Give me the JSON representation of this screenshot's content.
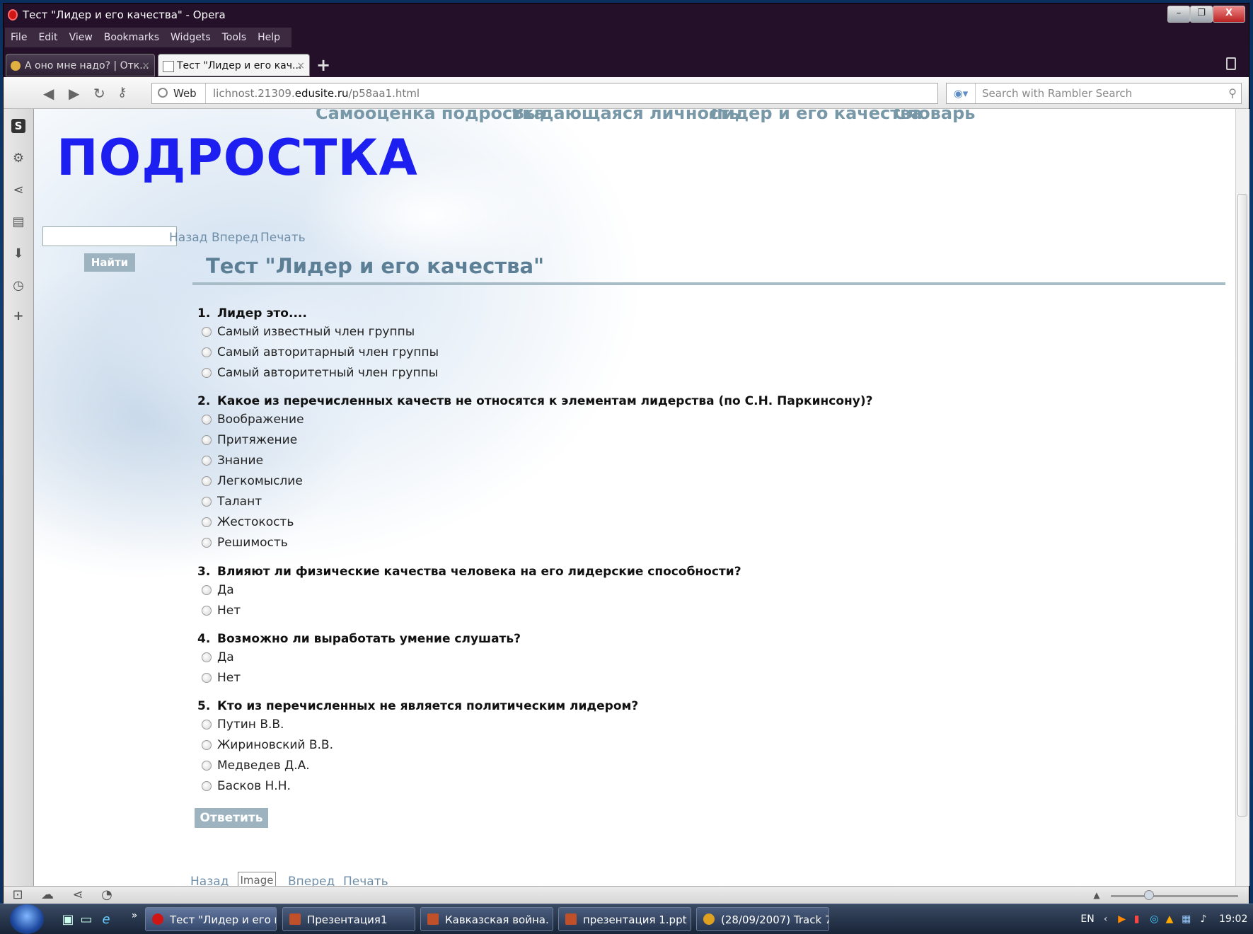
{
  "window": {
    "title": "Тест \"Лидер и его качества\" - Opera",
    "controls": {
      "minimize": "–",
      "restore": "❐",
      "close": "X"
    }
  },
  "menu": [
    "File",
    "Edit",
    "View",
    "Bookmarks",
    "Widgets",
    "Tools",
    "Help"
  ],
  "tabs": [
    {
      "label": "А оно мне надо? | Отк...",
      "active": false
    },
    {
      "label": "Тест \"Лидер и его кач...",
      "active": true
    }
  ],
  "toolbar": {
    "web_label": "Web",
    "url_plain": "lichnost.21309.",
    "url_host": "edusite.ru",
    "url_path": "/p58aa1.html",
    "search_placeholder": "Search with Rambler Search"
  },
  "site": {
    "nav": [
      "Самооценка подростка",
      "Выдающаяся личность",
      "Лидер и его качества",
      "Словарь"
    ],
    "title": "ПОДРОСТКА",
    "search_button": "Найти",
    "page_nav": [
      "Назад",
      "Вперед",
      "Печать"
    ],
    "page_title": "Тест \"Лидер и его качества\"",
    "submit": "Ответить",
    "image_alt": "Image"
  },
  "questions": [
    {
      "num": "1.",
      "text": "Лидер это....",
      "options": [
        "Самый известный член группы",
        "Самый авторитарный член группы",
        "Самый авторитетный член группы"
      ]
    },
    {
      "num": "2.",
      "text": "Какое из перечисленных качеств не относятся к элементам лидерства (по С.Н. Паркинсону)?",
      "options": [
        "Воображение",
        "Притяжение",
        "Знание",
        "Легкомыслие",
        "Талант",
        "Жестокость",
        "Решимость"
      ]
    },
    {
      "num": "3.",
      "text": "Влияют ли физические качества человека на его лидерские способности?",
      "options": [
        "Да",
        "Нет"
      ]
    },
    {
      "num": "4.",
      "text": "Возможно ли выработать умение слушать?",
      "options": [
        "Да",
        "Нет"
      ]
    },
    {
      "num": "5.",
      "text": "Кто из перечисленных не является политическим лидером?",
      "options": [
        "Путин В.В.",
        "Жириновский В.В.",
        "Медведев Д.А.",
        "Басков Н.Н."
      ]
    }
  ],
  "taskbar": {
    "tasks": [
      {
        "label": "Тест \"Лидер и его к...",
        "active": true,
        "color": "#d01515"
      },
      {
        "label": "Презентация1",
        "active": false,
        "color": "#c0502a"
      },
      {
        "label": "Кавказская война. ...",
        "active": false,
        "color": "#c0502a"
      },
      {
        "label": "презентация 1.ppt",
        "active": false,
        "color": "#c0502a"
      },
      {
        "label": "(28/09/2007) Track 7...",
        "active": false,
        "color": "#e0a020"
      }
    ],
    "lang": "EN",
    "clock": "19:02"
  }
}
